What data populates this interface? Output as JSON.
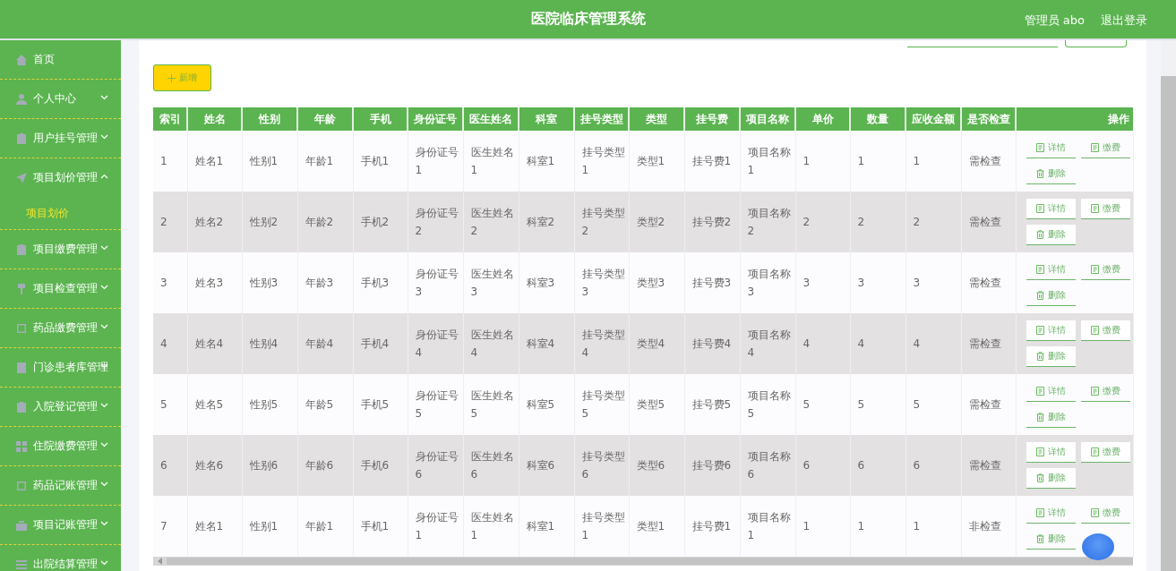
{
  "header": {
    "title": "医院临床管理系统",
    "user": "管理员 abo",
    "logout": "退出登录"
  },
  "sidebar": {
    "items": [
      {
        "label": "首页",
        "kind": "link",
        "expanded": false
      },
      {
        "label": "个人中心",
        "kind": "menu",
        "expanded": false
      },
      {
        "label": "用户挂号管理",
        "kind": "menu",
        "expanded": false
      },
      {
        "label": "项目划价管理",
        "kind": "menu",
        "expanded": true,
        "children": [
          {
            "label": "项目划价",
            "selected": true
          }
        ]
      },
      {
        "label": "项目缴费管理",
        "kind": "menu",
        "expanded": false
      },
      {
        "label": "项目检查管理",
        "kind": "menu",
        "expanded": false
      },
      {
        "label": "药品缴费管理",
        "kind": "menu",
        "expanded": false
      },
      {
        "label": "门诊患者库管理",
        "kind": "menu",
        "expanded": false
      },
      {
        "label": "入院登记管理",
        "kind": "menu",
        "expanded": false
      },
      {
        "label": "住院缴费管理",
        "kind": "menu",
        "expanded": false
      },
      {
        "label": "药品记账管理",
        "kind": "menu",
        "expanded": false
      },
      {
        "label": "项目记账管理",
        "kind": "menu",
        "expanded": false
      },
      {
        "label": "出院结算管理",
        "kind": "menu",
        "expanded": false
      }
    ]
  },
  "add_button": "新增",
  "table": {
    "columns": [
      "索引",
      "姓名",
      "性别",
      "年龄",
      "手机",
      "身份证号",
      "医生姓名",
      "科室",
      "挂号类型",
      "类型",
      "挂号费",
      "项目名称",
      "单价",
      "数量",
      "应收金额",
      "是否检查",
      "操作"
    ],
    "rows": [
      {
        "cells": [
          "1",
          "姓名1",
          "性别1",
          "年龄1",
          "手机1",
          "身份证号1",
          "医生姓名1",
          "科室1",
          "挂号类型1",
          "类型1",
          "挂号费1",
          "项目名称1",
          "1",
          "1",
          "1",
          "需检查"
        ],
        "actions": [
          {
            "kind": "detail",
            "label": "详情"
          },
          {
            "kind": "pay",
            "label": "缴费"
          },
          {
            "kind": "delete",
            "label": "删除"
          }
        ]
      },
      {
        "cells": [
          "2",
          "姓名2",
          "性别2",
          "年龄2",
          "手机2",
          "身份证号2",
          "医生姓名2",
          "科室2",
          "挂号类型2",
          "类型2",
          "挂号费2",
          "项目名称2",
          "2",
          "2",
          "2",
          "需检查"
        ],
        "actions": [
          {
            "kind": "detail",
            "label": "详情"
          },
          {
            "kind": "pay",
            "label": "缴费"
          },
          {
            "kind": "delete",
            "label": "删除"
          }
        ]
      },
      {
        "cells": [
          "3",
          "姓名3",
          "性别3",
          "年龄3",
          "手机3",
          "身份证号3",
          "医生姓名3",
          "科室3",
          "挂号类型3",
          "类型3",
          "挂号费3",
          "项目名称3",
          "3",
          "3",
          "3",
          "需检查"
        ],
        "actions": [
          {
            "kind": "detail",
            "label": "详情"
          },
          {
            "kind": "pay",
            "label": "缴费"
          },
          {
            "kind": "delete",
            "label": "删除"
          }
        ]
      },
      {
        "cells": [
          "4",
          "姓名4",
          "性别4",
          "年龄4",
          "手机4",
          "身份证号4",
          "医生姓名4",
          "科室4",
          "挂号类型4",
          "类型4",
          "挂号费4",
          "项目名称4",
          "4",
          "4",
          "4",
          "需检查"
        ],
        "actions": [
          {
            "kind": "detail",
            "label": "详情"
          },
          {
            "kind": "pay",
            "label": "缴费"
          },
          {
            "kind": "delete",
            "label": "删除"
          }
        ]
      },
      {
        "cells": [
          "5",
          "姓名5",
          "性别5",
          "年龄5",
          "手机5",
          "身份证号5",
          "医生姓名5",
          "科室5",
          "挂号类型5",
          "类型5",
          "挂号费5",
          "项目名称5",
          "5",
          "5",
          "5",
          "需检查"
        ],
        "actions": [
          {
            "kind": "detail",
            "label": "详情"
          },
          {
            "kind": "pay",
            "label": "缴费"
          },
          {
            "kind": "delete",
            "label": "删除"
          }
        ]
      },
      {
        "cells": [
          "6",
          "姓名6",
          "性别6",
          "年龄6",
          "手机6",
          "身份证号6",
          "医生姓名6",
          "科室6",
          "挂号类型6",
          "类型6",
          "挂号费6",
          "项目名称6",
          "6",
          "6",
          "6",
          "需检查"
        ],
        "actions": [
          {
            "kind": "detail",
            "label": "详情"
          },
          {
            "kind": "pay",
            "label": "缴费"
          },
          {
            "kind": "delete",
            "label": "删除"
          }
        ]
      },
      {
        "cells": [
          "7",
          "姓名1",
          "性别1",
          "年龄1",
          "手机1",
          "身份证号1",
          "医生姓名1",
          "科室1",
          "挂号类型1",
          "类型1",
          "挂号费1",
          "项目名称1",
          "1",
          "1",
          "1",
          "非检查"
        ],
        "actions": [
          {
            "kind": "detail",
            "label": "详情"
          },
          {
            "kind": "pay",
            "label": "缴费"
          },
          {
            "kind": "delete",
            "label": "删除"
          }
        ]
      }
    ]
  }
}
